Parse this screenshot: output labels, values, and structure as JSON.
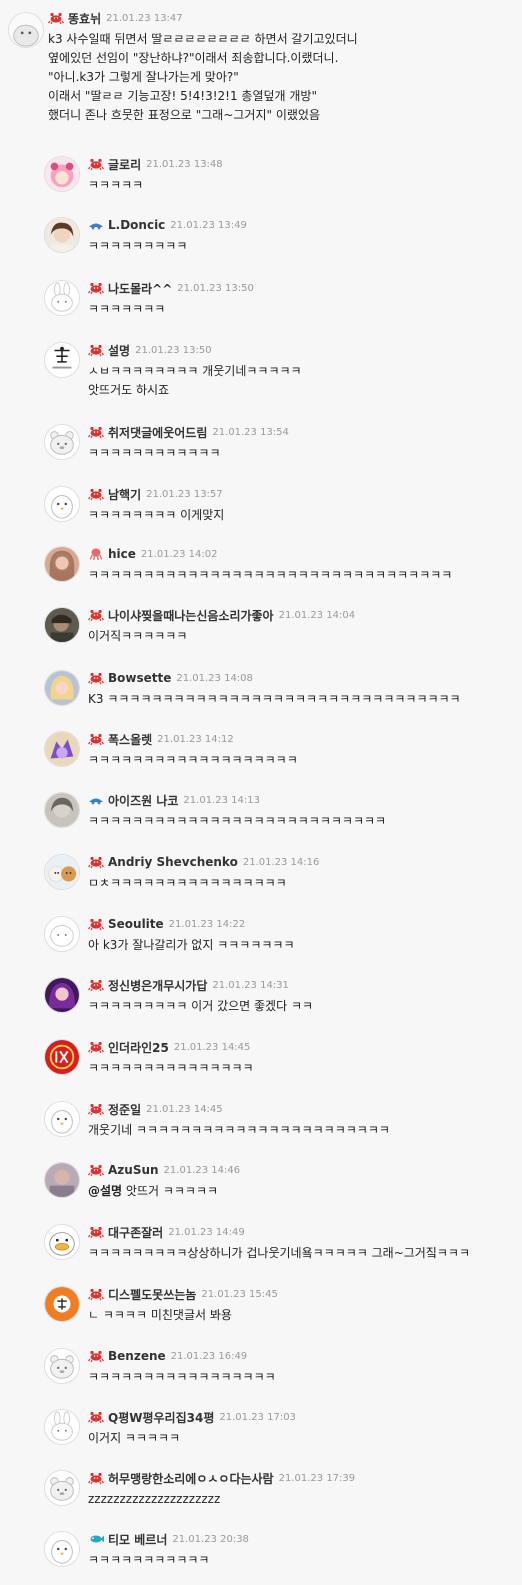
{
  "colors": {
    "background": "#f7f7f7",
    "text": "#222222",
    "nickname": "#333333",
    "timestamp": "#999999"
  },
  "comments": [
    {
      "nick": "똥효뉘",
      "time": "21.01.23 13:47",
      "badge": "crab-icon",
      "avatar": "plain",
      "lines": [
        "k3 사수일때 뒤면서 딸ㄹㄹㄹㄹㄹㄹㄹㄹ 하면서 갈기고있더니",
        "옆에있던 선임이 \"장난하냐?\"이래서 죄송합니다.이랬더니.",
        "\"아니.k3가 그렇게 잘나가는게 맞아?\"",
        "이래서 \"딸ㄹㄹ 기능고장! 5!4!3!2!1 총열덮개 개방\"",
        "했더니 존나 흐뭇한 표정으로 \"그래~그거지\" 이랬었음"
      ]
    },
    {
      "nick": "글로리",
      "time": "21.01.23 13:48",
      "badge": "crab-icon",
      "avatar": "pink",
      "lines": [
        "ㅋㅋㅋㅋㅋ"
      ]
    },
    {
      "nick": "L.Doncic",
      "time": "21.01.23 13:49",
      "badge": "fish-icon",
      "avatar": "face",
      "lines": [
        "ㅋㅋㅋㅋㅋㅋㅋㅋㅋ"
      ]
    },
    {
      "nick": "나도몰라^^",
      "time": "21.01.23 13:50",
      "badge": "crab-icon",
      "avatar": "rabbit",
      "lines": [
        "ㅋㅋㅋㅋㅋㅋㅋ"
      ]
    },
    {
      "nick": "설명",
      "time": "21.01.23 13:50",
      "badge": "crab-icon",
      "avatar": "logo",
      "lines": [
        "ㅅㅂㅋㅋㅋㅋㅋㅋㅋㅋ 개웃기네ㅋㅋㅋㅋㅋ",
        "앗뜨거도 하시죠"
      ]
    },
    {
      "nick": "취저댓글에웃어드림",
      "time": "21.01.23 13:54",
      "badge": "crab-icon",
      "avatar": "bear",
      "lines": [
        "ㅋㅋㅋㅋㅋㅋㅋㅋㅋㅋㅋㅋ"
      ]
    },
    {
      "nick": "남핵기",
      "time": "21.01.23 13:57",
      "badge": "crab-icon",
      "avatar": "penguin",
      "lines": [
        "ㅋㅋㅋㅋㅋㅋㅋㅋ 이게맞지"
      ]
    },
    {
      "nick": "hice",
      "time": "21.01.23 14:02",
      "badge": "octopus-icon",
      "avatar": "skin",
      "lines": [
        "ㅋㅋㅋㅋㅋㅋㅋㅋㅋㅋㅋㅋㅋㅋㅋㅋㅋㅋㅋㅋㅋㅋㅋㅋㅋㅋㅋㅋㅋㅋㅋㅋㅋ"
      ]
    },
    {
      "nick": "나이샤찢을때나는신음소리가좋아",
      "time": "21.01.23 14:04",
      "badge": "crab-icon",
      "avatar": "dark",
      "lines": [
        "이거직ㅋㅋㅋㅋㅋㅋ"
      ]
    },
    {
      "nick": "Bowsette",
      "time": "21.01.23 14:08",
      "badge": "crab-icon",
      "avatar": "blonde",
      "lines": [
        "K3 ㅋㅋㅋㅋㅋㅋㅋㅋㅋㅋㅋㅋㅋㅋㅋㅋㅋㅋㅋㅋㅋㅋㅋㅋㅋㅋㅋㅋㅋㅋㅋㅋ"
      ]
    },
    {
      "nick": "폭스올렛",
      "time": "21.01.23 14:12",
      "badge": "crab-icon",
      "avatar": "purple",
      "lines": [
        "ㅋㅋㅋㅋㅋㅋㅋㅋㅋㅋㅋㅋㅋㅋㅋㅋㅋㅋㅋ"
      ]
    },
    {
      "nick": "아이즈원 나코",
      "time": "21.01.23 14:13",
      "badge": "fish-icon",
      "avatar": "gray",
      "lines": [
        "ㅋㅋㅋㅋㅋㅋㅋㅋㅋㅋㅋㅋㅋㅋㅋㅋㅋㅋㅋㅋㅋㅋㅋㅋㅋㅋㅋ"
      ]
    },
    {
      "nick": "Andriy Shevchenko",
      "time": "21.01.23 14:16",
      "badge": "crab-icon",
      "avatar": "dogs",
      "lines": [
        "ㅁㅊㅋㅋㅋㅋㅋㅋㅋㅋㅋㅋㅋㅋㅋㅋㅋㅋ"
      ]
    },
    {
      "nick": "Seoulite",
      "time": "21.01.23 14:22",
      "badge": "crab-icon",
      "avatar": "blank",
      "lines": [
        "아 k3가 잘나갈리가 없지 ㅋㅋㅋㅋㅋㅋㅋ"
      ]
    },
    {
      "nick": "정신병은개무시가답",
      "time": "21.01.23 14:31",
      "badge": "crab-icon",
      "avatar": "violet",
      "lines": [
        "ㅋㅋㅋㅋㅋㅋㅋㅋㅋ 이거 갔으면 좋겠다 ㅋㅋ"
      ]
    },
    {
      "nick": "인더라인25",
      "time": "21.01.23 14:45",
      "badge": "crab-icon",
      "avatar": "red-logo",
      "lines": [
        "ㅋㅋㅋㅋㅋㅋㅋㅋㅋㅋㅋㅋㅋㅋㅋ"
      ]
    },
    {
      "nick": "정준일",
      "time": "21.01.23 14:45",
      "badge": "crab-icon",
      "avatar": "penguin",
      "lines": [
        "개웃기네 ㅋㅋㅋㅋㅋㅋㅋㅋㅋㅋㅋㅋㅋㅋㅋㅋㅋㅋㅋㅋㅋㅋㅋ"
      ]
    },
    {
      "nick": "AzuSun",
      "time": "21.01.23 14:46",
      "badge": "crab-icon",
      "avatar": "photo",
      "mention": "@설명",
      "lines": [
        " 앗뜨거 ㅋㅋㅋㅋㅋ"
      ]
    },
    {
      "nick": "대구존잘러",
      "time": "21.01.23 14:49",
      "badge": "crab-icon",
      "avatar": "duck",
      "lines": [
        "ㅋㅋㅋㅋㅋㅋㅋㅋㅋ상상하니가 겁나웃기네욬ㅋㅋㅋㅋㅋ 그래~그거짘ㅋㅋㅋ"
      ]
    },
    {
      "nick": "디스펠도못쓰는놈",
      "time": "21.01.23 15:45",
      "badge": "crab-icon",
      "avatar": "orange",
      "lines": [
        "ㄴ ㅋㅋㅋㅋ 미친댓글서 봐용"
      ]
    },
    {
      "nick": "Benzene",
      "time": "21.01.23 16:49",
      "badge": "crab-icon",
      "avatar": "bear",
      "lines": [
        "ㅋㅋㅋㅋㅋㅋㅋㅋㅋㅋㅋㅋㅋㅋㅋㅋㅋ"
      ]
    },
    {
      "nick": "Q평W평우리집34평",
      "time": "21.01.23 17:03",
      "badge": "crab-icon",
      "avatar": "rabbit",
      "lines": [
        "이거지 ㅋㅋㅋㅋㅋ"
      ]
    },
    {
      "nick": "허무맹랑한소리에ㅇㅅㅇ다는사람",
      "time": "21.01.23 17:39",
      "badge": "crab-icon",
      "avatar": "bear",
      "lines": [
        "zzzzzzzzzzzzzzzzzzzzz"
      ]
    },
    {
      "nick": "티모 베르너",
      "time": "21.01.23 20:38",
      "badge": "fish-cyan-icon",
      "avatar": "penguin",
      "lines": [
        "ㅋㅋㅋㅋㅋㅋㅋㅋㅋㅋㅋ"
      ]
    }
  ]
}
